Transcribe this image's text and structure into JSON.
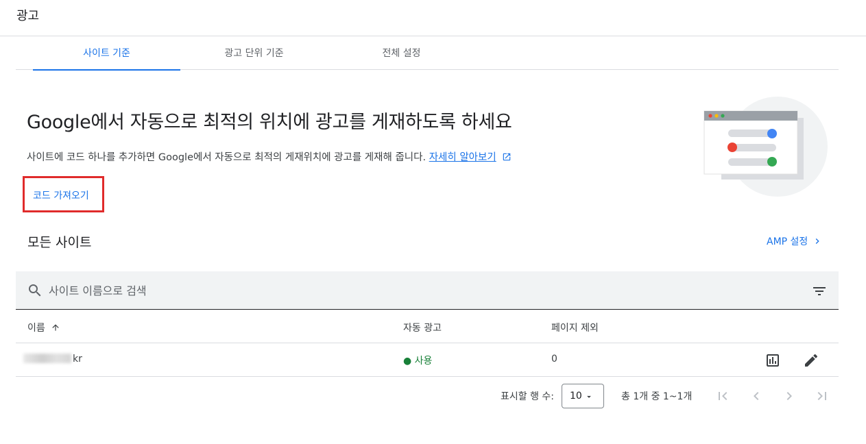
{
  "header": {
    "title": "광고"
  },
  "tabs": [
    {
      "label": "사이트 기준",
      "active": true
    },
    {
      "label": "광고 단위 기준",
      "active": false
    },
    {
      "label": "전체 설정",
      "active": false
    }
  ],
  "hero": {
    "title": "Google에서 자동으로 최적의 위치에 광고를 게재하도록 하세요",
    "description": "사이트에 코드 하나를 추가하면 Google에서 자동으로 최적의 게재위치에 광고를 게재해 줍니다.",
    "learn_more": "자세히 알아보기",
    "get_code_label": "코드 가져오기"
  },
  "sites": {
    "title": "모든 사이트",
    "amp_settings": "AMP 설정",
    "search_placeholder": "사이트 이름으로 검색",
    "columns": {
      "name": "이름",
      "auto_ads": "자동 광고",
      "excluded_pages": "페이지 제외"
    },
    "rows": [
      {
        "name": "kr",
        "auto_ads": "● 사용",
        "excluded_pages": "0"
      }
    ]
  },
  "pagination": {
    "rows_per_page_label": "표시할 행 수:",
    "rows_per_page": "10",
    "range": "총 1개 중 1~1개"
  },
  "colors": {
    "accent": "#1a73e8",
    "active_status": "#188038",
    "highlight_border": "#e02b2b"
  },
  "icons": [
    "external-link-icon",
    "chevron-right-icon",
    "search-icon",
    "filter-icon",
    "arrow-up-icon",
    "bar-chart-icon",
    "edit-icon",
    "dropdown-arrow-icon",
    "first-page-icon",
    "prev-page-icon",
    "next-page-icon",
    "last-page-icon"
  ]
}
